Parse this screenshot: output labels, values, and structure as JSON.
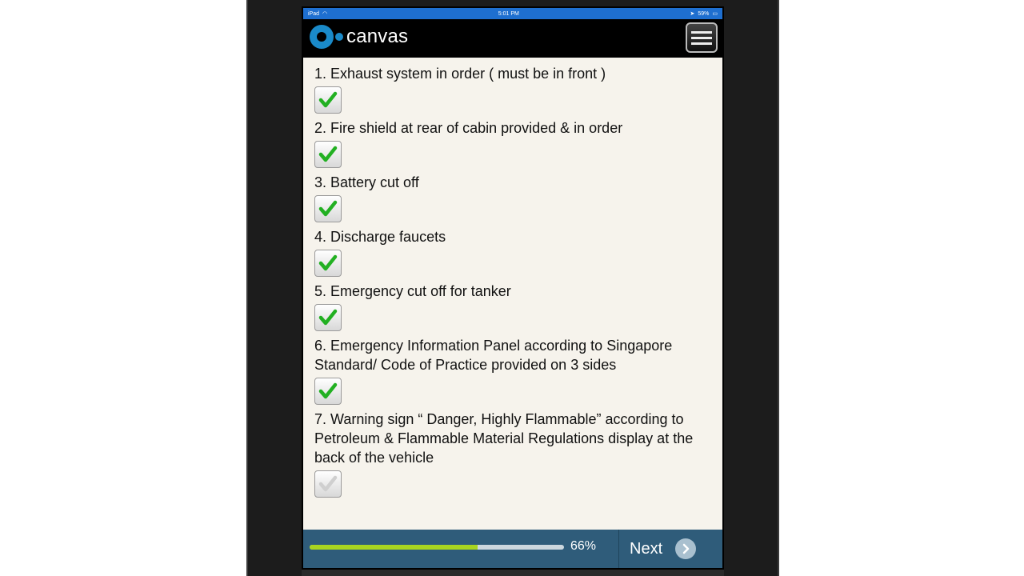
{
  "status": {
    "device": "iPad",
    "time": "5:01 PM",
    "battery": "59%"
  },
  "app": {
    "name": "canvas",
    "menu_icon": "hamburger-menu-icon"
  },
  "checklist": [
    {
      "label": "1. Exhaust system in order ( must be in front )",
      "checked": true
    },
    {
      "label": "2. Fire shield at rear of cabin provided & in order",
      "checked": true
    },
    {
      "label": "3. Battery cut off",
      "checked": true
    },
    {
      "label": "4. Discharge faucets",
      "checked": true
    },
    {
      "label": "5. Emergency cut off for tanker",
      "checked": true
    },
    {
      "label": "6. Emergency Information Panel according to Singapore Standard/ Code of Practice provided on 3 sides",
      "checked": true
    },
    {
      "label": "7. Warning sign “ Danger, Highly Flammable” according to Petroleum & Flammable Material Regulations display at the back of the vehicle",
      "checked": false
    }
  ],
  "footer": {
    "progress_percent": 66,
    "progress_label": "66%",
    "next_label": "Next"
  },
  "colors": {
    "status_bar": "#1e6fd0",
    "brand": "#1a8ac9",
    "check_green": "#22b022",
    "check_disabled": "#cfcfcf",
    "progress_fill": "#a8d420",
    "footer_bg": "#2f5c7a"
  }
}
